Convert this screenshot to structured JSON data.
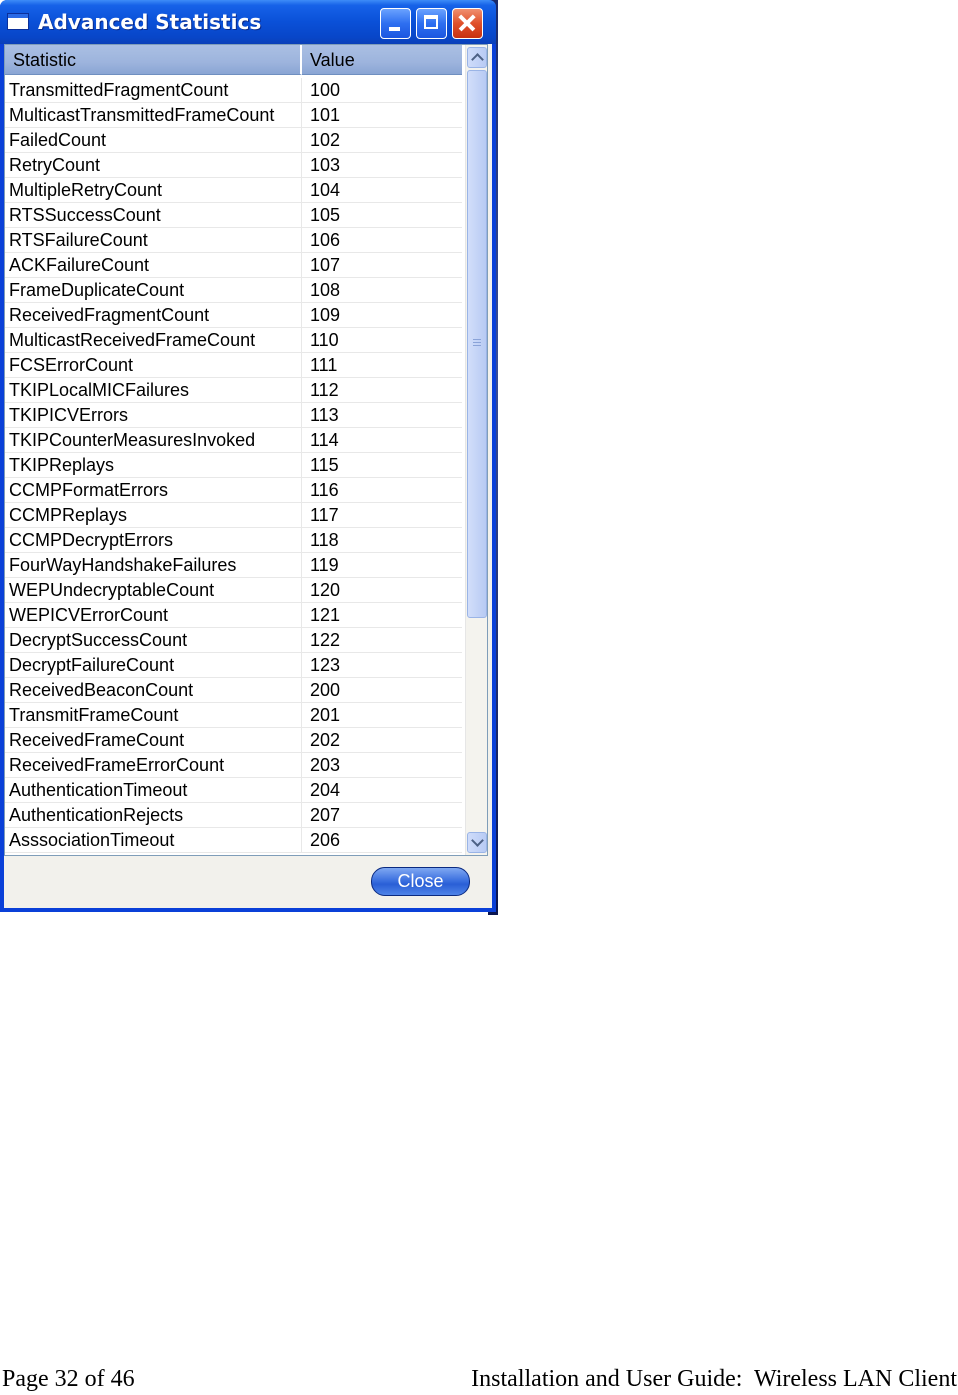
{
  "window": {
    "title": "Advanced Statistics",
    "minimize_icon": "minimize-icon",
    "maximize_icon": "maximize-icon",
    "close_icon": "close-icon",
    "title_icon": "window-icon"
  },
  "table": {
    "columns": [
      "Statistic",
      "Value"
    ],
    "rows": [
      {
        "statistic": "TransmittedFragmentCount",
        "value": "100"
      },
      {
        "statistic": "MulticastTransmittedFrameCount",
        "value": "101"
      },
      {
        "statistic": "FailedCount",
        "value": "102"
      },
      {
        "statistic": "RetryCount",
        "value": "103"
      },
      {
        "statistic": "MultipleRetryCount",
        "value": "104"
      },
      {
        "statistic": "RTSSuccessCount",
        "value": "105"
      },
      {
        "statistic": "RTSFailureCount",
        "value": "106"
      },
      {
        "statistic": "ACKFailureCount",
        "value": "107"
      },
      {
        "statistic": "FrameDuplicateCount",
        "value": "108"
      },
      {
        "statistic": "ReceivedFragmentCount",
        "value": "109"
      },
      {
        "statistic": "MulticastReceivedFrameCount",
        "value": "110"
      },
      {
        "statistic": "FCSErrorCount",
        "value": "111"
      },
      {
        "statistic": "TKIPLocalMICFailures",
        "value": "112"
      },
      {
        "statistic": "TKIPICVErrors",
        "value": "113"
      },
      {
        "statistic": "TKIPCounterMeasuresInvoked",
        "value": "114"
      },
      {
        "statistic": "TKIPReplays",
        "value": "115"
      },
      {
        "statistic": "CCMPFormatErrors",
        "value": "116"
      },
      {
        "statistic": "CCMPReplays",
        "value": "117"
      },
      {
        "statistic": "CCMPDecryptErrors",
        "value": "118"
      },
      {
        "statistic": "FourWayHandshakeFailures",
        "value": "119"
      },
      {
        "statistic": "WEPUndecryptableCount",
        "value": "120"
      },
      {
        "statistic": "WEPICVErrorCount",
        "value": "121"
      },
      {
        "statistic": "DecryptSuccessCount",
        "value": "122"
      },
      {
        "statistic": "DecryptFailureCount",
        "value": "123"
      },
      {
        "statistic": "ReceivedBeaconCount",
        "value": "200"
      },
      {
        "statistic": "TransmitFrameCount",
        "value": "201"
      },
      {
        "statistic": "ReceivedFrameCount",
        "value": "202"
      },
      {
        "statistic": "ReceivedFrameErrorCount",
        "value": "203"
      },
      {
        "statistic": "AuthenticationTimeout",
        "value": "204"
      },
      {
        "statistic": "AuthenticationRejects",
        "value": "207"
      },
      {
        "statistic": "AsssociationTimeout",
        "value": "206"
      }
    ]
  },
  "buttons": {
    "close_label": "Close"
  },
  "footer": {
    "page": "Page 32 of 46",
    "guide": "Installation and User Guide:  Wireless LAN Client"
  },
  "colors": {
    "titlebar": "#0a50d8",
    "header": "#9db4dd",
    "client_background": "#f4f3ee"
  }
}
